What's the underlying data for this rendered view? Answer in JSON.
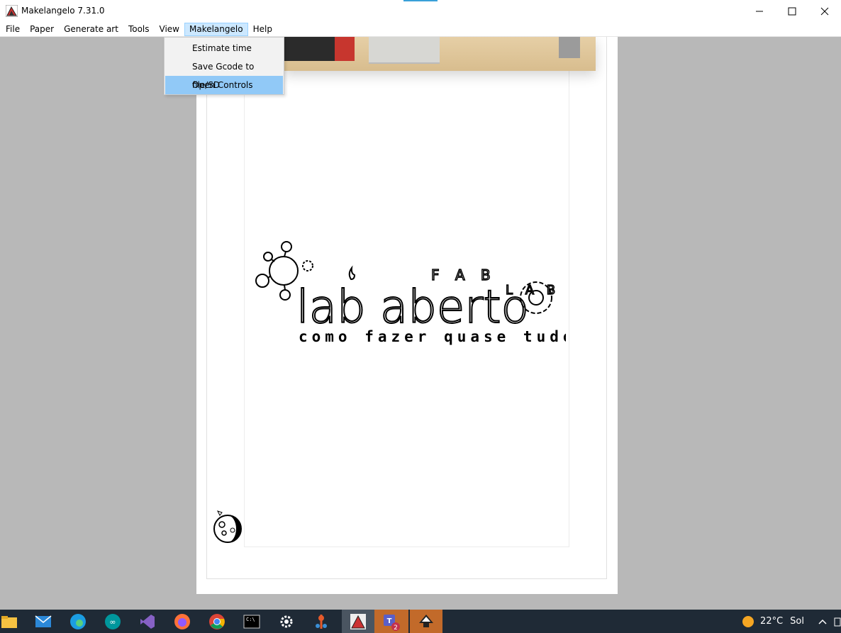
{
  "window": {
    "title": "Makelangelo 7.31.0"
  },
  "menu": {
    "items": [
      "File",
      "Paper",
      "Generate art",
      "Tools",
      "View",
      "Makelangelo",
      "Help"
    ],
    "active_index": 5
  },
  "dropdown": {
    "items": [
      {
        "label": "Estimate time"
      },
      {
        "label": "Save Gcode to file/SD"
      },
      {
        "label": "Open Controls"
      }
    ],
    "highlighted_index": 2
  },
  "artwork": {
    "main_text": "lab aberto",
    "sub_text": "como fazer quase tudo",
    "fab_text": "F A B",
    "lab_text": "L A B"
  },
  "taskbar": {
    "apps": [
      "file-explorer",
      "mail",
      "edge",
      "arduino",
      "visual-studio",
      "firefox",
      "chrome",
      "terminal",
      "settings",
      "git-app",
      "makelangelo",
      "teams",
      "inkscape"
    ],
    "teams_badge": "2",
    "weather": {
      "temp": "22°C",
      "condition": "Sol"
    }
  },
  "colors": {
    "workspace_bg": "#b8b8b8",
    "menu_highlight": "#91c9f7",
    "taskbar_bg": "#1f2a36"
  }
}
